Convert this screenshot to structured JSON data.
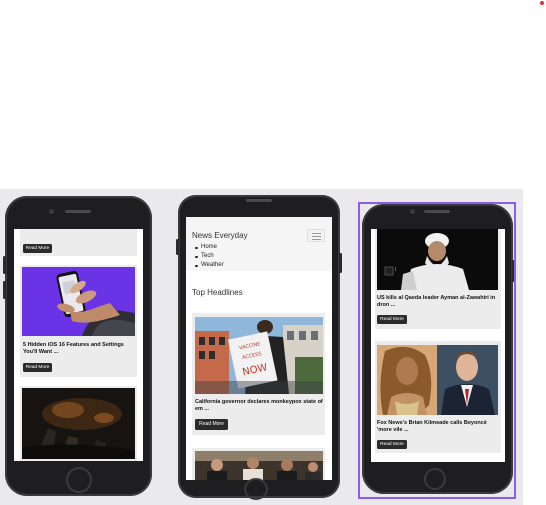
{
  "site": {
    "brand": "News Everyday",
    "nav_items": [
      "Home",
      "Tech",
      "Weather"
    ],
    "section_title": "Top Headlines"
  },
  "read_more_label": "Read More",
  "phone1": {
    "articles": [
      {
        "title": "5 Hidden iOS 16 Features and Settings You'll Want ..."
      }
    ]
  },
  "phone2": {
    "articles": [
      {
        "title": "California governor declares monkeypox state of em ...",
        "sign_text": "VACCINE ACCESS NOW"
      }
    ]
  },
  "phone3": {
    "articles": [
      {
        "title": "US kills al Qaeda leader Ayman al-Zawahiri in dron ..."
      },
      {
        "title": "Fox News's Brian Kilmeade calls Beyoncé 'more vile ..."
      }
    ]
  },
  "colors": {
    "selection": "#8a5cf0",
    "button": "#2b2b2b",
    "card": "#ececec",
    "phone_body": "#1e1e20",
    "showcase_bg": "#eaeaee"
  }
}
